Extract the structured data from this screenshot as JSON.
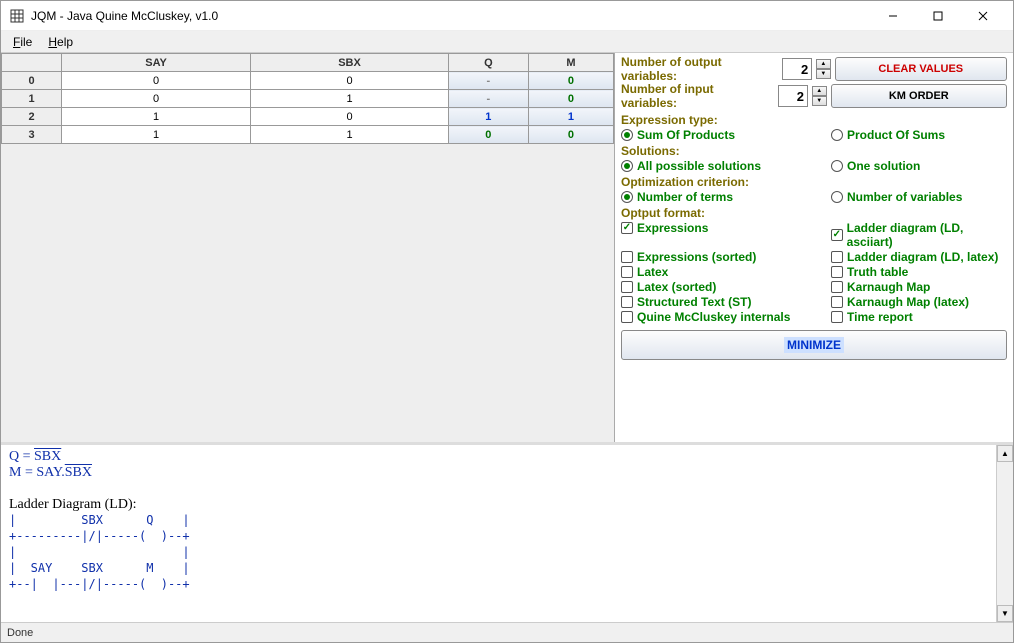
{
  "window": {
    "title": "JQM - Java Quine McCluskey, v1.0"
  },
  "menus": {
    "file": "File",
    "help": "Help"
  },
  "table": {
    "headers": [
      "",
      "SAY",
      "SBX",
      "Q",
      "M"
    ],
    "rows": [
      {
        "idx": "0",
        "say": "0",
        "sbx": "0",
        "q": "-",
        "m": "0"
      },
      {
        "idx": "1",
        "say": "0",
        "sbx": "1",
        "q": "-",
        "m": "0"
      },
      {
        "idx": "2",
        "say": "1",
        "sbx": "0",
        "q": "1",
        "m": "1"
      },
      {
        "idx": "3",
        "say": "1",
        "sbx": "1",
        "q": "0",
        "m": "0"
      }
    ]
  },
  "controls": {
    "num_output_label": "Number of output variables:",
    "num_output_value": "2",
    "num_input_label": "Number  of  input  variables:",
    "num_input_value": "2",
    "clear_label": "CLEAR VALUES",
    "km_label": "KM ORDER",
    "expr_type_label": "Expression type:",
    "sum_products": "Sum Of Products",
    "product_sums": "Product Of Sums",
    "solutions_label": "Solutions:",
    "all_solutions": "All possible solutions",
    "one_solution": "One solution",
    "opt_crit_label": "Optimization criterion:",
    "num_terms": "Number of terms",
    "num_vars": "Number of variables",
    "output_format_label": "Optput format:",
    "expressions": "Expressions",
    "ladder_ascii": "Ladder diagram (LD, asciiart)",
    "expressions_sorted": "Expressions (sorted)",
    "ladder_latex": "Ladder diagram (LD, latex)",
    "latex": "Latex",
    "truth_table": "Truth table",
    "latex_sorted": "Latex (sorted)",
    "karnaugh": "Karnaugh Map",
    "structured_text": "Structured Text (ST)",
    "karnaugh_latex": "Karnaugh Map (latex)",
    "qmc_internals": "Quine McCluskey internals",
    "time_report": "Time report",
    "minimize_label": "MINIMIZE"
  },
  "output": {
    "q_eq_prefix": "Q = ",
    "q_eq_over": "SBX",
    "m_eq_prefix": "M = SAY.",
    "m_eq_over": "SBX",
    "ladder_heading": "Ladder Diagram (LD):",
    "ladder_line1": "|         SBX      Q    |",
    "ladder_line2": "+---------|/|-----(  )--+",
    "ladder_line3": "|                       |",
    "ladder_line4": "|  SAY    SBX      M    |",
    "ladder_line5": "+--|  |---|/|-----(  )--+"
  },
  "status": {
    "text": "Done"
  }
}
